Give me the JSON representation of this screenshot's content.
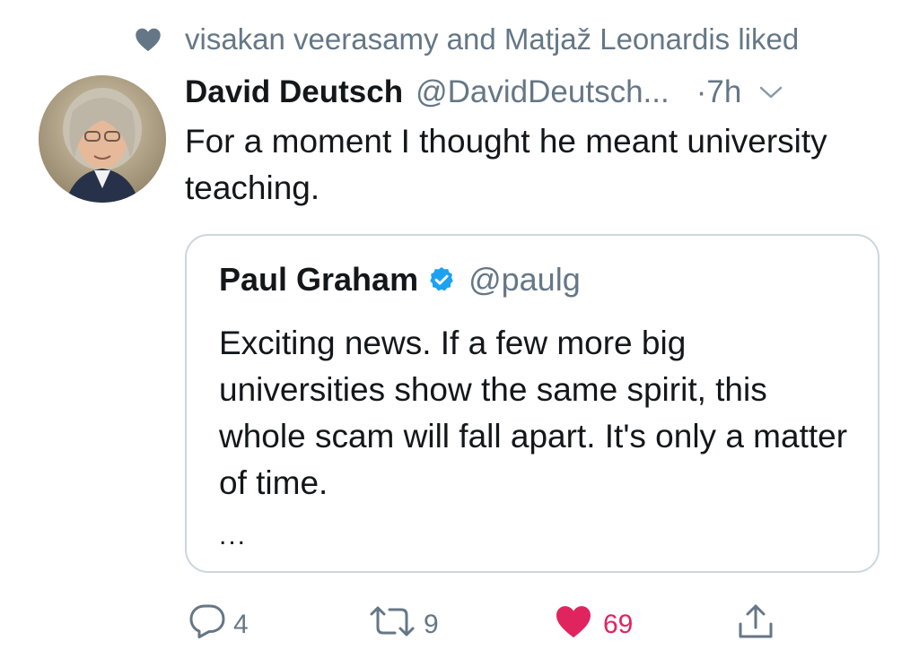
{
  "social_context": {
    "text": "visakan veerasamy and Matjaž Leonardis liked",
    "icon": "heart-icon"
  },
  "tweet": {
    "display_name": "David Deutsch",
    "handle": "@DavidDeutsch...",
    "time": "·7h",
    "text": "For a moment I thought he meant university teaching.",
    "avatar_icon": "avatar-photo"
  },
  "quote": {
    "display_name": "Paul Graham",
    "verified": true,
    "handle": "@paulg",
    "text": "Exciting news. If a few more big universities show the same spirit, this whole scam will fall apart. It's only a matter of time.",
    "more": "..."
  },
  "actions": {
    "reply_count": "4",
    "retweet_count": "9",
    "like_count": "69",
    "liked": true
  },
  "colors": {
    "text": "#14171a",
    "secondary": "#657786",
    "like": "#e0245e",
    "verified": "#1da1f2",
    "border": "#ccd6dd"
  }
}
